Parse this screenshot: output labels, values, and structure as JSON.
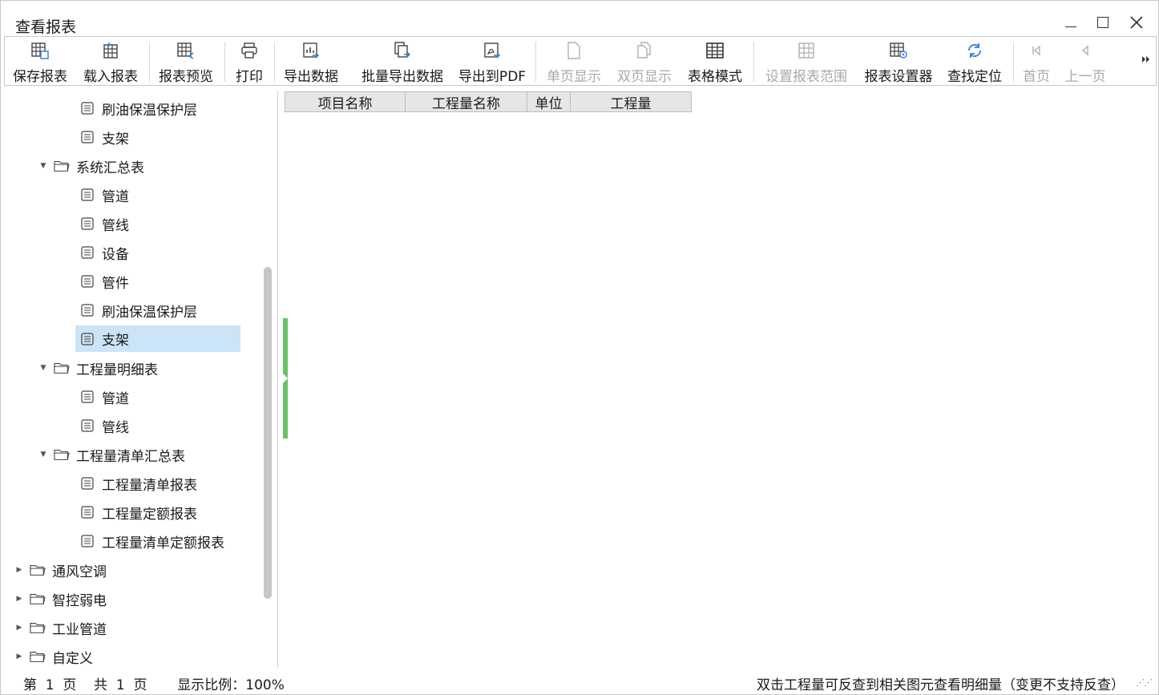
{
  "window": {
    "title": "查看报表"
  },
  "toolbar": {
    "buttons": [
      {
        "label": "保存报表",
        "icon": "save-grid-icon",
        "enabled": true
      },
      {
        "label": "载入报表",
        "icon": "load-grid-icon",
        "enabled": true
      },
      {
        "label": "报表预览",
        "icon": "preview-grid-icon",
        "enabled": true
      },
      {
        "label": "打印",
        "icon": "printer-icon",
        "enabled": true
      },
      {
        "label": "导出数据",
        "icon": "export-data-icon",
        "enabled": true
      },
      {
        "label": "批量导出数据",
        "icon": "batch-export-icon",
        "enabled": true
      },
      {
        "label": "导出到PDF",
        "icon": "pdf-icon",
        "enabled": true
      },
      {
        "label": "单页显示",
        "icon": "single-page-icon",
        "enabled": false
      },
      {
        "label": "双页显示",
        "icon": "double-page-icon",
        "enabled": false
      },
      {
        "label": "表格模式",
        "icon": "table-icon",
        "enabled": true
      },
      {
        "label": "设置报表范围",
        "icon": "range-grid-icon",
        "enabled": false
      },
      {
        "label": "报表设置器",
        "icon": "grid-settings-icon",
        "enabled": true
      },
      {
        "label": "查找定位",
        "icon": "refresh-locate-icon",
        "enabled": true
      },
      {
        "label": "首页",
        "icon": "first-page-icon",
        "enabled": false
      },
      {
        "label": "上一页",
        "icon": "prev-page-icon",
        "enabled": false
      }
    ]
  },
  "tree": {
    "items": [
      {
        "label": "刷油保温保护层",
        "type": "doc",
        "level": 2,
        "selected": false
      },
      {
        "label": "支架",
        "type": "doc",
        "level": 2,
        "selected": false
      },
      {
        "label": "系统汇总表",
        "type": "folder",
        "level": 1,
        "expanded": true
      },
      {
        "label": "管道",
        "type": "doc",
        "level": 2,
        "selected": false
      },
      {
        "label": "管线",
        "type": "doc",
        "level": 2,
        "selected": false
      },
      {
        "label": "设备",
        "type": "doc",
        "level": 2,
        "selected": false
      },
      {
        "label": "管件",
        "type": "doc",
        "level": 2,
        "selected": false
      },
      {
        "label": "刷油保温保护层",
        "type": "doc",
        "level": 2,
        "selected": false
      },
      {
        "label": "支架",
        "type": "doc",
        "level": 2,
        "selected": true
      },
      {
        "label": "工程量明细表",
        "type": "folder",
        "level": 1,
        "expanded": true
      },
      {
        "label": "管道",
        "type": "doc",
        "level": 2,
        "selected": false
      },
      {
        "label": "管线",
        "type": "doc",
        "level": 2,
        "selected": false
      },
      {
        "label": "工程量清单汇总表",
        "type": "folder",
        "level": 1,
        "expanded": true
      },
      {
        "label": "工程量清单报表",
        "type": "doc",
        "level": 2,
        "selected": false
      },
      {
        "label": "工程量定额报表",
        "type": "doc",
        "level": 2,
        "selected": false
      },
      {
        "label": "工程量清单定额报表",
        "type": "doc",
        "level": 2,
        "selected": false
      },
      {
        "label": "通风空调",
        "type": "folder",
        "level": 0,
        "expanded": false
      },
      {
        "label": "智控弱电",
        "type": "folder",
        "level": 0,
        "expanded": false
      },
      {
        "label": "工业管道",
        "type": "folder",
        "level": 0,
        "expanded": false
      },
      {
        "label": "自定义",
        "type": "folder",
        "level": 0,
        "expanded": false
      }
    ]
  },
  "grid": {
    "columns": [
      "项目名称",
      "工程量名称",
      "单位",
      "工程量"
    ]
  },
  "status": {
    "page_info": "第  1  页    共  1  页       显示比例：100%",
    "hint": "双击工程量可反查到相关图元查看明细量（变更不支持反查）"
  }
}
